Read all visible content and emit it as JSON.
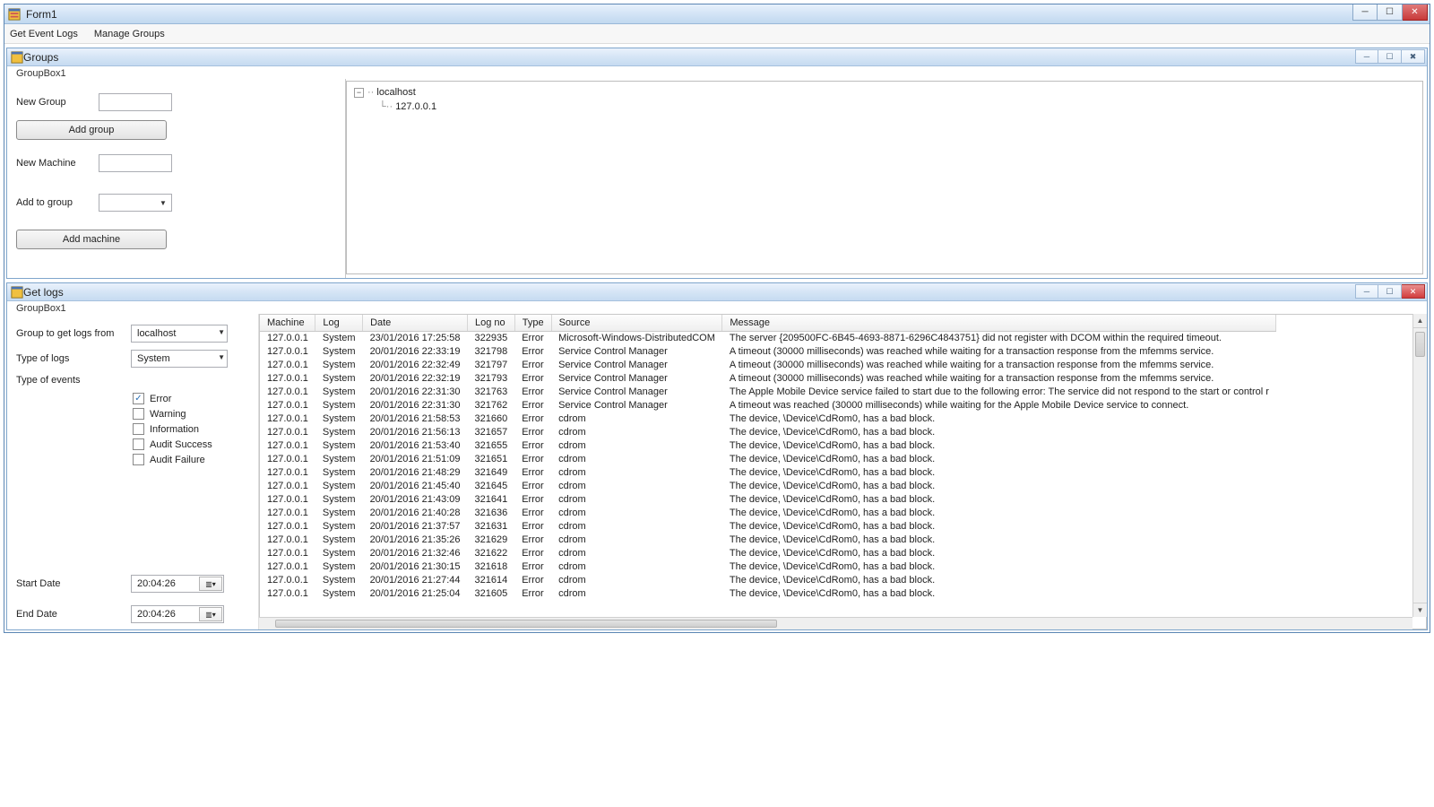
{
  "main_window": {
    "title": "Form1"
  },
  "menu": {
    "items": [
      "Get Event Logs",
      "Manage Groups"
    ]
  },
  "groups_window": {
    "title": "Groups",
    "groupbox_label": "GroupBox1",
    "labels": {
      "new_group": "New Group",
      "new_machine": "New Machine",
      "add_to_group": "Add to group"
    },
    "buttons": {
      "add_group": "Add group",
      "add_machine": "Add machine"
    },
    "tree": {
      "root": "localhost",
      "children": [
        "127.0.0.1"
      ]
    }
  },
  "getlogs_window": {
    "title": "Get logs",
    "groupbox_label": "GroupBox1",
    "labels": {
      "group_from": "Group to get logs from",
      "type_logs": "Type of logs",
      "type_events": "Type of events",
      "start_date": "Start Date",
      "end_date": "End Date"
    },
    "combos": {
      "group_from": "localhost",
      "type_logs": "System"
    },
    "check_labels": {
      "error": "Error",
      "warning": "Warning",
      "information": "Information",
      "audit_success": "Audit Success",
      "audit_failure": "Audit Failure"
    },
    "checks": {
      "error": true,
      "warning": false,
      "information": false,
      "audit_success": false,
      "audit_failure": false
    },
    "start_date": "20:04:26",
    "end_date": "20:04:26",
    "columns": [
      "Machine",
      "Log",
      "Date",
      "Log no",
      "Type",
      "Source",
      "Message"
    ],
    "rows": [
      {
        "machine": "127.0.0.1",
        "log": "System",
        "date": "23/01/2016 17:25:58",
        "logno": "322935",
        "type": "Error",
        "source": "Microsoft-Windows-DistributedCOM",
        "message": "The server {209500FC-6B45-4693-8871-6296C4843751} did not register with DCOM within the required timeout."
      },
      {
        "machine": "127.0.0.1",
        "log": "System",
        "date": "20/01/2016 22:33:19",
        "logno": "321798",
        "type": "Error",
        "source": "Service Control Manager",
        "message": "A timeout (30000 milliseconds) was reached while waiting for a transaction response from the mfemms service."
      },
      {
        "machine": "127.0.0.1",
        "log": "System",
        "date": "20/01/2016 22:32:49",
        "logno": "321797",
        "type": "Error",
        "source": "Service Control Manager",
        "message": "A timeout (30000 milliseconds) was reached while waiting for a transaction response from the mfemms service."
      },
      {
        "machine": "127.0.0.1",
        "log": "System",
        "date": "20/01/2016 22:32:19",
        "logno": "321793",
        "type": "Error",
        "source": "Service Control Manager",
        "message": "A timeout (30000 milliseconds) was reached while waiting for a transaction response from the mfemms service."
      },
      {
        "machine": "127.0.0.1",
        "log": "System",
        "date": "20/01/2016 22:31:30",
        "logno": "321763",
        "type": "Error",
        "source": "Service Control Manager",
        "message": "The Apple Mobile Device service failed to start due to the following error: The service did not respond to the start or control r"
      },
      {
        "machine": "127.0.0.1",
        "log": "System",
        "date": "20/01/2016 22:31:30",
        "logno": "321762",
        "type": "Error",
        "source": "Service Control Manager",
        "message": "A timeout was reached (30000 milliseconds) while waiting for the Apple Mobile Device service to connect."
      },
      {
        "machine": "127.0.0.1",
        "log": "System",
        "date": "20/01/2016 21:58:53",
        "logno": "321660",
        "type": "Error",
        "source": "cdrom",
        "message": "The device, \\Device\\CdRom0, has a bad block."
      },
      {
        "machine": "127.0.0.1",
        "log": "System",
        "date": "20/01/2016 21:56:13",
        "logno": "321657",
        "type": "Error",
        "source": "cdrom",
        "message": "The device, \\Device\\CdRom0, has a bad block."
      },
      {
        "machine": "127.0.0.1",
        "log": "System",
        "date": "20/01/2016 21:53:40",
        "logno": "321655",
        "type": "Error",
        "source": "cdrom",
        "message": "The device, \\Device\\CdRom0, has a bad block."
      },
      {
        "machine": "127.0.0.1",
        "log": "System",
        "date": "20/01/2016 21:51:09",
        "logno": "321651",
        "type": "Error",
        "source": "cdrom",
        "message": "The device, \\Device\\CdRom0, has a bad block."
      },
      {
        "machine": "127.0.0.1",
        "log": "System",
        "date": "20/01/2016 21:48:29",
        "logno": "321649",
        "type": "Error",
        "source": "cdrom",
        "message": "The device, \\Device\\CdRom0, has a bad block."
      },
      {
        "machine": "127.0.0.1",
        "log": "System",
        "date": "20/01/2016 21:45:40",
        "logno": "321645",
        "type": "Error",
        "source": "cdrom",
        "message": "The device, \\Device\\CdRom0, has a bad block."
      },
      {
        "machine": "127.0.0.1",
        "log": "System",
        "date": "20/01/2016 21:43:09",
        "logno": "321641",
        "type": "Error",
        "source": "cdrom",
        "message": "The device, \\Device\\CdRom0, has a bad block."
      },
      {
        "machine": "127.0.0.1",
        "log": "System",
        "date": "20/01/2016 21:40:28",
        "logno": "321636",
        "type": "Error",
        "source": "cdrom",
        "message": "The device, \\Device\\CdRom0, has a bad block."
      },
      {
        "machine": "127.0.0.1",
        "log": "System",
        "date": "20/01/2016 21:37:57",
        "logno": "321631",
        "type": "Error",
        "source": "cdrom",
        "message": "The device, \\Device\\CdRom0, has a bad block."
      },
      {
        "machine": "127.0.0.1",
        "log": "System",
        "date": "20/01/2016 21:35:26",
        "logno": "321629",
        "type": "Error",
        "source": "cdrom",
        "message": "The device, \\Device\\CdRom0, has a bad block."
      },
      {
        "machine": "127.0.0.1",
        "log": "System",
        "date": "20/01/2016 21:32:46",
        "logno": "321622",
        "type": "Error",
        "source": "cdrom",
        "message": "The device, \\Device\\CdRom0, has a bad block."
      },
      {
        "machine": "127.0.0.1",
        "log": "System",
        "date": "20/01/2016 21:30:15",
        "logno": "321618",
        "type": "Error",
        "source": "cdrom",
        "message": "The device, \\Device\\CdRom0, has a bad block."
      },
      {
        "machine": "127.0.0.1",
        "log": "System",
        "date": "20/01/2016 21:27:44",
        "logno": "321614",
        "type": "Error",
        "source": "cdrom",
        "message": "The device, \\Device\\CdRom0, has a bad block."
      },
      {
        "machine": "127.0.0.1",
        "log": "System",
        "date": "20/01/2016 21:25:04",
        "logno": "321605",
        "type": "Error",
        "source": "cdrom",
        "message": "The device, \\Device\\CdRom0, has a bad block."
      }
    ]
  }
}
